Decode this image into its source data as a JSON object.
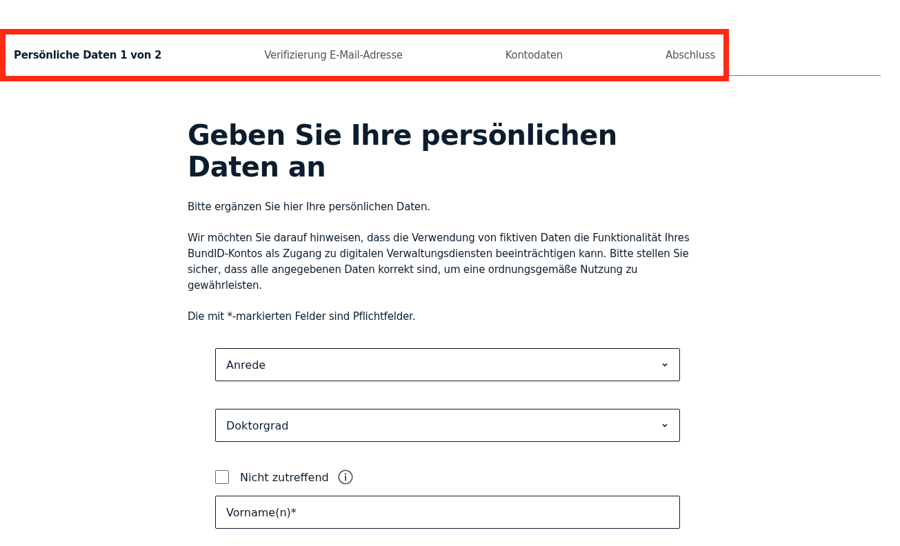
{
  "steps": [
    {
      "label": "Persönliche Daten 1 von 2",
      "selected": true
    },
    {
      "label": "Verifizierung E-Mail-Adresse",
      "selected": false
    },
    {
      "label": "Kontodaten",
      "selected": false
    },
    {
      "label": "Abschluss",
      "selected": false
    }
  ],
  "heading": "Geben Sie Ihre persönlichen Daten an",
  "paragraphs": [
    "Bitte ergänzen Sie hier Ihre persönlichen Daten.",
    "Wir möchten Sie darauf hinweisen, dass die Verwendung von fiktiven Daten die Funktionalität Ihres BundID-Kontos als Zugang zu digitalen Verwaltungsdiensten beeinträchtigen kann. Bitte stellen Sie sicher, dass alle angegebenen Daten korrekt sind, um eine ordnungsgemäße Nutzung zu gewährleisten.",
    "Die mit *-markierten Felder sind Pflichtfelder."
  ],
  "fields": [
    {
      "kind": "select",
      "placeholder": "Anrede"
    },
    {
      "kind": "select",
      "placeholder": "Doktorgrad"
    },
    {
      "kind": "checkbox",
      "label": "Nicht zutreffend",
      "checked": false
    },
    {
      "kind": "input",
      "placeholder": "Vorname(n)*"
    }
  ]
}
